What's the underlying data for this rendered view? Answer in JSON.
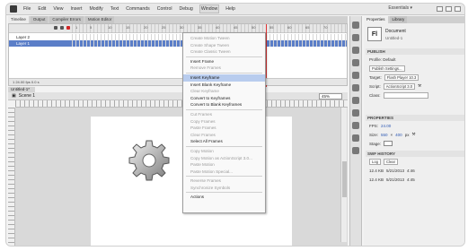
{
  "menubar": {
    "items": [
      "File",
      "Edit",
      "View",
      "Insert",
      "Modify",
      "Text",
      "Commands",
      "Control",
      "Debug",
      "Window",
      "Help"
    ],
    "active": "Window",
    "workspace": "Essentials ▾"
  },
  "timeline": {
    "tabs": [
      "Timeline",
      "Output",
      "Compiler Errors",
      "Motion Editor"
    ],
    "frame_numbers": [
      "1",
      "5",
      "10",
      "15",
      "20",
      "25",
      "30",
      "35",
      "40",
      "45",
      "50",
      "55",
      "60",
      "65",
      "70"
    ],
    "layers": [
      {
        "name": "Layer 2",
        "selected": false
      },
      {
        "name": "Layer 1",
        "selected": true
      }
    ],
    "footer": "1  24.00 fps  0.0 s"
  },
  "scene": {
    "tab": "Untitled-1*",
    "name": "Scene 1",
    "zoom": "45%"
  },
  "context_menu": {
    "items": [
      {
        "label": "Create Motion Tween",
        "state": "dim"
      },
      {
        "label": "Create Shape Tween",
        "state": "dim"
      },
      {
        "label": "Create Classic Tween",
        "state": "dim"
      },
      {
        "sep": true
      },
      {
        "label": "Insert Frame",
        "state": "normal"
      },
      {
        "label": "Remove Frames",
        "state": "dim"
      },
      {
        "sep": true
      },
      {
        "label": "Insert Keyframe",
        "state": "hi"
      },
      {
        "label": "Insert Blank Keyframe",
        "state": "normal"
      },
      {
        "label": "Clear Keyframe",
        "state": "dim"
      },
      {
        "label": "Convert to Keyframes",
        "state": "normal"
      },
      {
        "label": "Convert to Blank Keyframes",
        "state": "normal"
      },
      {
        "sep": true
      },
      {
        "label": "Cut Frames",
        "state": "dim"
      },
      {
        "label": "Copy Frames",
        "state": "dim"
      },
      {
        "label": "Paste Frames",
        "state": "dim"
      },
      {
        "label": "Clear Frames",
        "state": "dim"
      },
      {
        "label": "Select All Frames",
        "state": "normal"
      },
      {
        "sep": true
      },
      {
        "label": "Copy Motion",
        "state": "dim"
      },
      {
        "label": "Copy Motion as ActionScript 3.0...",
        "state": "dim"
      },
      {
        "label": "Paste Motion",
        "state": "dim"
      },
      {
        "label": "Paste Motion Special...",
        "state": "dim"
      },
      {
        "sep": true
      },
      {
        "label": "Reverse Frames",
        "state": "dim"
      },
      {
        "label": "Synchronize Symbols",
        "state": "dim"
      },
      {
        "sep": true
      },
      {
        "label": "Actions",
        "state": "normal"
      }
    ]
  },
  "properties": {
    "tabs": [
      "Properties",
      "Library"
    ],
    "doc_type": "Document",
    "doc_file": "Untitled-1",
    "logo": "Fl",
    "publish_header": "PUBLISH",
    "profile_label": "Profile: Default",
    "publish_settings": "Publish Settings...",
    "target_label": "Target:",
    "target_value": "Flash Player 10.3",
    "script_label": "Script:",
    "script_value": "ActionScript 3.0",
    "class_label": "Class:",
    "props_header": "PROPERTIES",
    "fps_label": "FPS:",
    "fps_value": "24.00",
    "size_label": "Size:",
    "size_w": "550",
    "size_h": "400",
    "size_unit": "px",
    "stage_label": "Stage:",
    "swf_header": "SWF HISTORY",
    "log_btn": "Log",
    "clear_btn": "Clear",
    "history": [
      {
        "size": "12.4 KB",
        "date": "5/21/2013",
        "time": "4:46"
      },
      {
        "size": "12.4 KB",
        "date": "5/21/2013",
        "time": "4:45"
      }
    ]
  }
}
